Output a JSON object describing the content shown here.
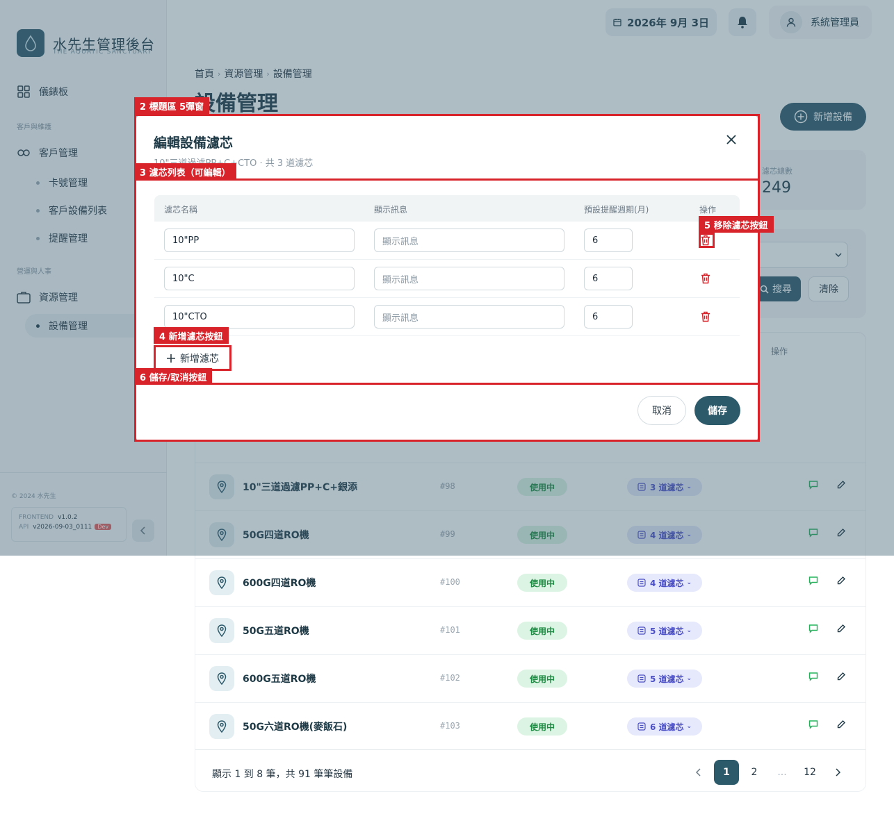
{
  "brand": {
    "title": "水先生管理後台",
    "subtitle": "THE AQUATIC SANCTUARY"
  },
  "sidebar": {
    "dashboard": "儀錶板",
    "section1": "客戶與維護",
    "customers": "客戶管理",
    "card_mgmt": "卡號管理",
    "customer_devices": "客戶設備列表",
    "reminders": "提醒管理",
    "section2": "營運與人事",
    "resources": "資源管理",
    "devices": "設備管理",
    "copyright": "© 2024 水先生",
    "frontend_label": "FRONTEND",
    "frontend_version": "v1.0.2",
    "api_label": "API",
    "api_version": "v2026-09-03_0111",
    "dev_badge": "Dev"
  },
  "topbar": {
    "date": "2026年 9月 3日",
    "user": "系統管理員"
  },
  "breadcrumb": [
    "首頁",
    "資源管理",
    "設備管理"
  ],
  "page": {
    "title": "設備管理",
    "add_button": "新增設備"
  },
  "stat": {
    "label": "濾芯總數",
    "value": "249"
  },
  "filter": {
    "search": "搜尋",
    "clear": "清除"
  },
  "table": {
    "action_header": "操作",
    "rows": [
      {
        "name": "10\"三道過濾PP+C+銀添",
        "code": "#98",
        "status": "使用中",
        "filters": "3 道濾芯"
      },
      {
        "name": "50G四道RO機",
        "code": "#99",
        "status": "使用中",
        "filters": "4 道濾芯"
      },
      {
        "name": "600G四道RO機",
        "code": "#100",
        "status": "使用中",
        "filters": "4 道濾芯"
      },
      {
        "name": "50G五道RO機",
        "code": "#101",
        "status": "使用中",
        "filters": "5 道濾芯"
      },
      {
        "name": "600G五道RO機",
        "code": "#102",
        "status": "使用中",
        "filters": "5 道濾芯"
      },
      {
        "name": "50G六道RO機(麥飯石)",
        "code": "#103",
        "status": "使用中",
        "filters": "6 道濾芯"
      }
    ],
    "pager_text": "顯示 1 到 8 筆，共 91 筆筆設備",
    "pages": [
      "1",
      "2",
      "...",
      "12"
    ]
  },
  "modal": {
    "title": "編輯設備濾芯",
    "subtitle": "10\"三道過濾PP+C+CTO · 共 3 道濾芯",
    "columns": [
      "濾芯名稱",
      "顯示訊息",
      "預設提醒週期(月)",
      "操作"
    ],
    "message_placeholder": "顯示訊息",
    "rows": [
      {
        "name": "10\"PP",
        "period": "6"
      },
      {
        "name": "10\"C",
        "period": "6"
      },
      {
        "name": "10\"CTO",
        "period": "6"
      }
    ],
    "add_filter": "新增濾芯",
    "cancel": "取消",
    "save": "儲存"
  },
  "annotations": {
    "a2": "2 標題區 5彈窗",
    "a3": "3 濾芯列表（可編輯）",
    "a4": "4 新增濾芯按鈕",
    "a5": "5 移除濾芯按鈕",
    "a6": "6 儲存/取消按鈕"
  }
}
